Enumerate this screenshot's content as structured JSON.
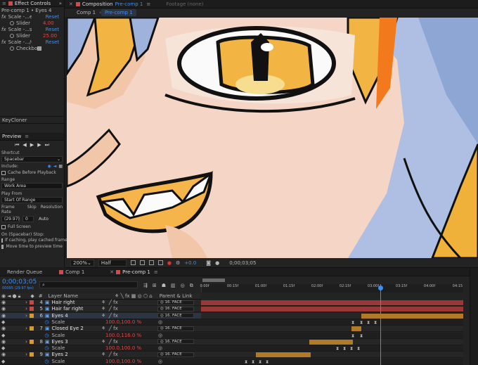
{
  "effect_controls": {
    "tab_label": "Effect Controls",
    "breadcrumb": "Pre-comp 1 • Eyes 4",
    "effects": [
      {
        "fx": "fx",
        "name": "Scale -...ess",
        "reset": "Reset",
        "param": "Slider",
        "value": "4.00"
      },
      {
        "fx": "fx",
        "name": "Scale -...sion",
        "reset": "Reset",
        "param": "Slider",
        "value": "25.00"
      },
      {
        "fx": "fx",
        "name": "Scale -.../Off",
        "reset": "Reset",
        "param": "Checkbox",
        "checked": true
      }
    ]
  },
  "keycloner": {
    "label": "KeyCloner"
  },
  "preview": {
    "title": "Preview",
    "shortcut_label": "Shortcut",
    "shortcut_value": "Spacebar",
    "include_label": "Include:",
    "cache_label": "Cache Before Playback",
    "range_label": "Range",
    "range_value": "Work Area",
    "play_from_label": "Play From",
    "play_from_value": "Start Of Range",
    "frame_rate_label": "Frame Rate",
    "skip_label": "Skip",
    "resolution_label": "Resolution",
    "frame_rate_value": "(29.97)",
    "skip_value": "0",
    "resolution_value": "Auto",
    "full_screen_label": "Full Screen",
    "stop_label": "On (Spacebar) Stop:",
    "if_caching_label": "If caching, play cached frames",
    "move_time_label": "Move time to preview time"
  },
  "top_tabs": {
    "composition_label": "Composition",
    "composition_name": "Pre-comp 1",
    "footage_label": "Footage (none)"
  },
  "viewer_tabs": [
    "Comp 1",
    "Pre-comp 1"
  ],
  "viewer_bar": {
    "zoom": "200%",
    "resolution": "Half",
    "exposure": "+0.0",
    "timecode": "0;00;03;05"
  },
  "timeline": {
    "tabs": [
      "Render Queue",
      "Comp 1",
      "Pre-comp 1"
    ],
    "current_time": "0;00;03;05",
    "fps_info": "00095 (29.97 fps)",
    "ruler_ticks": [
      "0:00f",
      "00:15f",
      "01:00f",
      "01:15f",
      "02:00f",
      "02:15f",
      "03:00f",
      "03:15f",
      "04:00f",
      "04:15"
    ],
    "col_layer_name": "Layer Name",
    "col_parent": "Parent & Link",
    "rows": [
      {
        "type": "layer",
        "num": "4",
        "name": "Hair right",
        "color": "#c24a4a",
        "parent": "16. FACE"
      },
      {
        "type": "layer",
        "num": "5",
        "name": "Hair far right",
        "color": "#c24a4a",
        "parent": "16. FACE"
      },
      {
        "type": "layer",
        "num": "6",
        "name": "Eyes 4",
        "color": "#d89a2e",
        "parent": "16. FACE"
      },
      {
        "type": "prop",
        "name": "Scale",
        "value": "100.0,100.0 %"
      },
      {
        "type": "layer",
        "num": "7",
        "name": "Closed Eye 2",
        "color": "#d89a2e",
        "parent": "16. FACE"
      },
      {
        "type": "prop",
        "name": "Scale",
        "value": "100.0,116.0 %"
      },
      {
        "type": "layer",
        "num": "8",
        "name": "Eyes 3",
        "color": "#d89a2e",
        "parent": "16. FACE"
      },
      {
        "type": "prop",
        "name": "Scale",
        "value": "100.0,100.0 %"
      },
      {
        "type": "layer",
        "num": "9",
        "name": "Eyes 2",
        "color": "#d89a2e",
        "parent": "16. FACE"
      },
      {
        "type": "prop",
        "name": "Scale",
        "value": "100.0,100.0 %"
      }
    ]
  },
  "colors": {
    "accent": "#3e8ff2",
    "red_label": "#c24a4a",
    "orange_label": "#d89a2e"
  }
}
